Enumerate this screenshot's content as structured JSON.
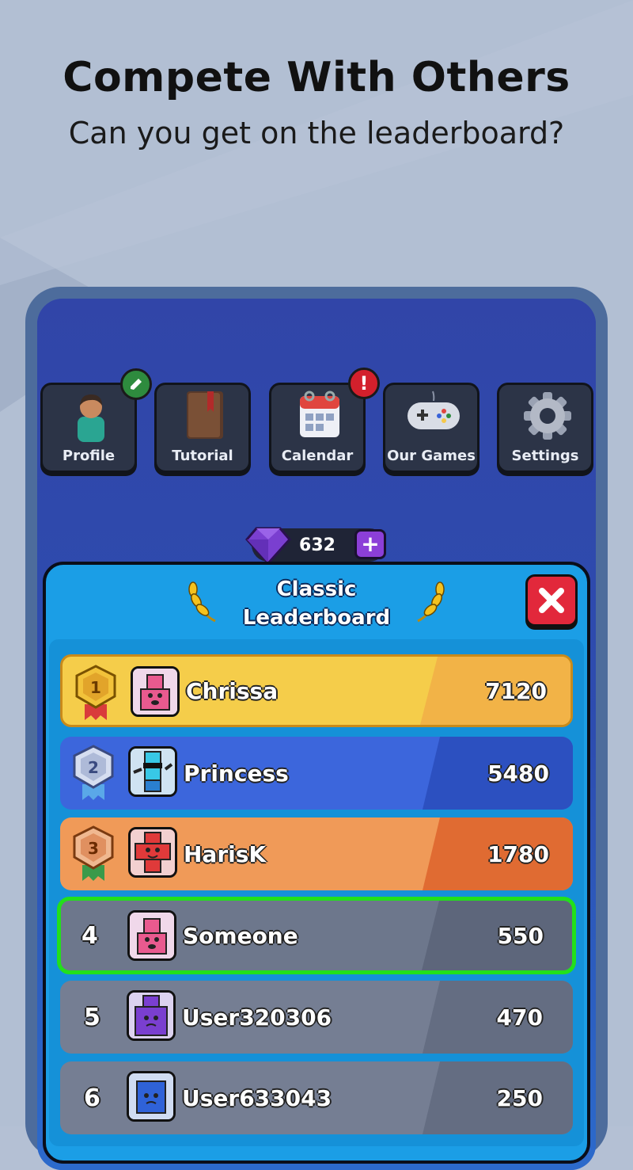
{
  "promo": {
    "headline": "Compete With Others",
    "subheadline": "Can you get on the leaderboard?"
  },
  "menu": [
    {
      "label": "Profile",
      "icon": "person-icon"
    },
    {
      "label": "Tutorial",
      "icon": "book-icon"
    },
    {
      "label": "Calendar",
      "icon": "calendar-icon"
    },
    {
      "label": "Our Games",
      "icon": "gamepad-icon"
    },
    {
      "label": "Settings",
      "icon": "gear-icon"
    }
  ],
  "badges": {
    "profile_edit": "pencil-icon",
    "calendar_alert": "!"
  },
  "gems": {
    "count": "632",
    "icon": "gem-icon",
    "add": "+"
  },
  "leaderboard": {
    "title_line1": "Classic",
    "title_line2": "Leaderboard",
    "rows": [
      {
        "rank": "1",
        "name": "Chrissa",
        "score": "7120"
      },
      {
        "rank": "2",
        "name": "Princess",
        "score": "5480"
      },
      {
        "rank": "3",
        "name": "HarisK",
        "score": "1780"
      },
      {
        "rank": "4",
        "name": "Someone",
        "score": "550"
      },
      {
        "rank": "5",
        "name": "User320306",
        "score": "470"
      },
      {
        "rank": "6",
        "name": "User633043",
        "score": "250"
      }
    ]
  },
  "colors": {
    "gold": "#f5c84a",
    "silver_blue": "#3a63d8",
    "bronze": "#ee9a55",
    "highlight": "#22e01b",
    "gray_row": "#757e93",
    "panel": "#1b9ee6"
  }
}
